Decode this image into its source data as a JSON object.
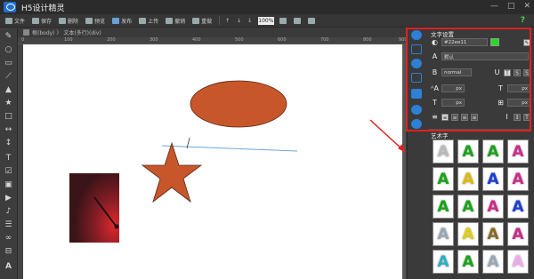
{
  "window": {
    "title": "H5设计精灵",
    "controls": [
      "—",
      "□",
      "✕"
    ]
  },
  "toolbar": {
    "items": [
      {
        "label": "文件",
        "icon": "file-icon"
      },
      {
        "label": "保存",
        "icon": "save-icon"
      },
      {
        "label": "删除",
        "icon": "delete-icon"
      },
      {
        "label": "预览",
        "icon": "preview-icon"
      },
      {
        "label": "发布",
        "icon": "publish-icon"
      },
      {
        "label": "上传",
        "icon": "upload-icon"
      },
      {
        "label": "撤销",
        "icon": "undo-icon"
      },
      {
        "label": "重做",
        "icon": "redo-icon"
      }
    ],
    "zoom": "100%",
    "help": "?"
  },
  "breadcrumb": {
    "text": "根(body) 〉 文本(多行)(div)"
  },
  "ruler": {
    "ticks": [
      "0",
      "100",
      "200",
      "300",
      "400",
      "500",
      "600",
      "700",
      "800",
      "900"
    ]
  },
  "canvas": {
    "shape_color": "#c8562b",
    "line_color": "#6aa6d8",
    "image_desc_colors": {
      "bg": "#6a1a22",
      "glow": "#e0282c"
    }
  },
  "panel": {
    "text_settings_title": "文字设置",
    "color_value": "#22ee11",
    "font_value": "默认",
    "weight_value": "normal",
    "size_unit": "px",
    "line_unit": "px",
    "spacing_unit": "px",
    "indent_unit": "px",
    "art_title": "艺术字",
    "accent": "#e02020"
  },
  "art_letters": [
    {
      "c": "#e8e8e8",
      "fill": "#bbb"
    },
    {
      "c": "#19a319",
      "fill": "#19a319"
    },
    {
      "c": "#19a319",
      "fill": "#19a319"
    },
    {
      "c": "#cc2a8a",
      "fill": "#cc2a8a"
    },
    {
      "c": "#19a319",
      "fill": "#19a319"
    },
    {
      "c": "#e0b800",
      "fill": "#e0b800"
    },
    {
      "c": "#1c3fd0",
      "fill": "#1c3fd0"
    },
    {
      "c": "#cc2a8a",
      "fill": "#cc2a8a"
    },
    {
      "c": "#19a319",
      "fill": "#19a319"
    },
    {
      "c": "#19a319",
      "fill": "#19a319"
    },
    {
      "c": "#cc2a8a",
      "fill": "#cc2a8a"
    },
    {
      "c": "#1c3fd0",
      "fill": "#1c3fd0"
    },
    {
      "c": "#9aa7b8",
      "fill": "#9aa7b8"
    },
    {
      "c": "#e0d000",
      "fill": "#e0d000"
    },
    {
      "c": "#8a6a20",
      "fill": "#8a6a20"
    },
    {
      "c": "#cc2a8a",
      "fill": "#cc2a8a"
    },
    {
      "c": "#2ab0c0",
      "fill": "#2ab0c0"
    },
    {
      "c": "#19a319",
      "fill": "#19a319"
    },
    {
      "c": "#9aa7b8",
      "fill": "#9aa7b8"
    },
    {
      "c": "#f2a8f0",
      "fill": "#f2a8f0"
    }
  ],
  "art_char": "A"
}
